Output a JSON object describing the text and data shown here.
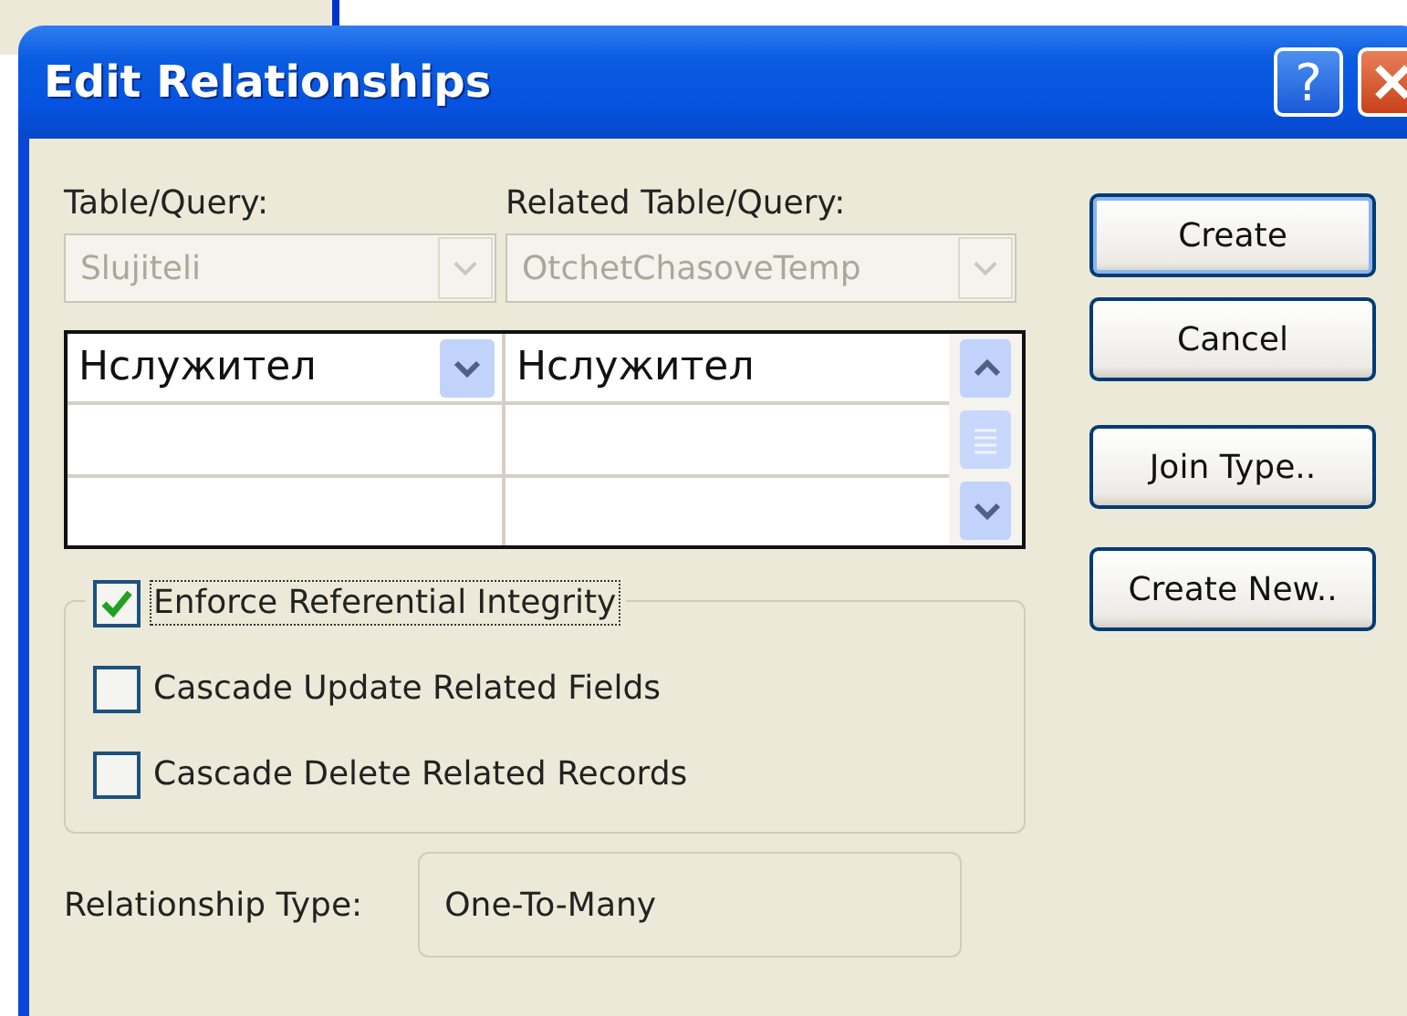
{
  "window": {
    "title": "Edit Relationships",
    "help_label": "?"
  },
  "table_query": {
    "label": "Table/Query:",
    "value": "Slujiteli",
    "disabled": true
  },
  "related_table_query": {
    "label": "Related Table/Query:",
    "value": "OtchetChasoveTemp",
    "disabled": true
  },
  "fields_grid": {
    "rows": [
      {
        "table_field": "Нслужител",
        "related_field": "Нслужител",
        "focused": true
      }
    ]
  },
  "options": [
    {
      "label": "Enforce Referential Integrity",
      "checked": true,
      "focused": true
    },
    {
      "label": "Cascade Update Related Fields",
      "checked": false,
      "focused": false
    },
    {
      "label": "Cascade Delete Related Records",
      "checked": false,
      "focused": false
    }
  ],
  "relationship_type": {
    "label": "Relationship Type:",
    "value": "One-To-Many"
  },
  "buttons": [
    {
      "label": "Create",
      "default": true
    },
    {
      "label": "Cancel",
      "default": false
    },
    {
      "label": "Join Type..",
      "default": false
    },
    {
      "label": "Create New..",
      "default": false
    }
  ]
}
